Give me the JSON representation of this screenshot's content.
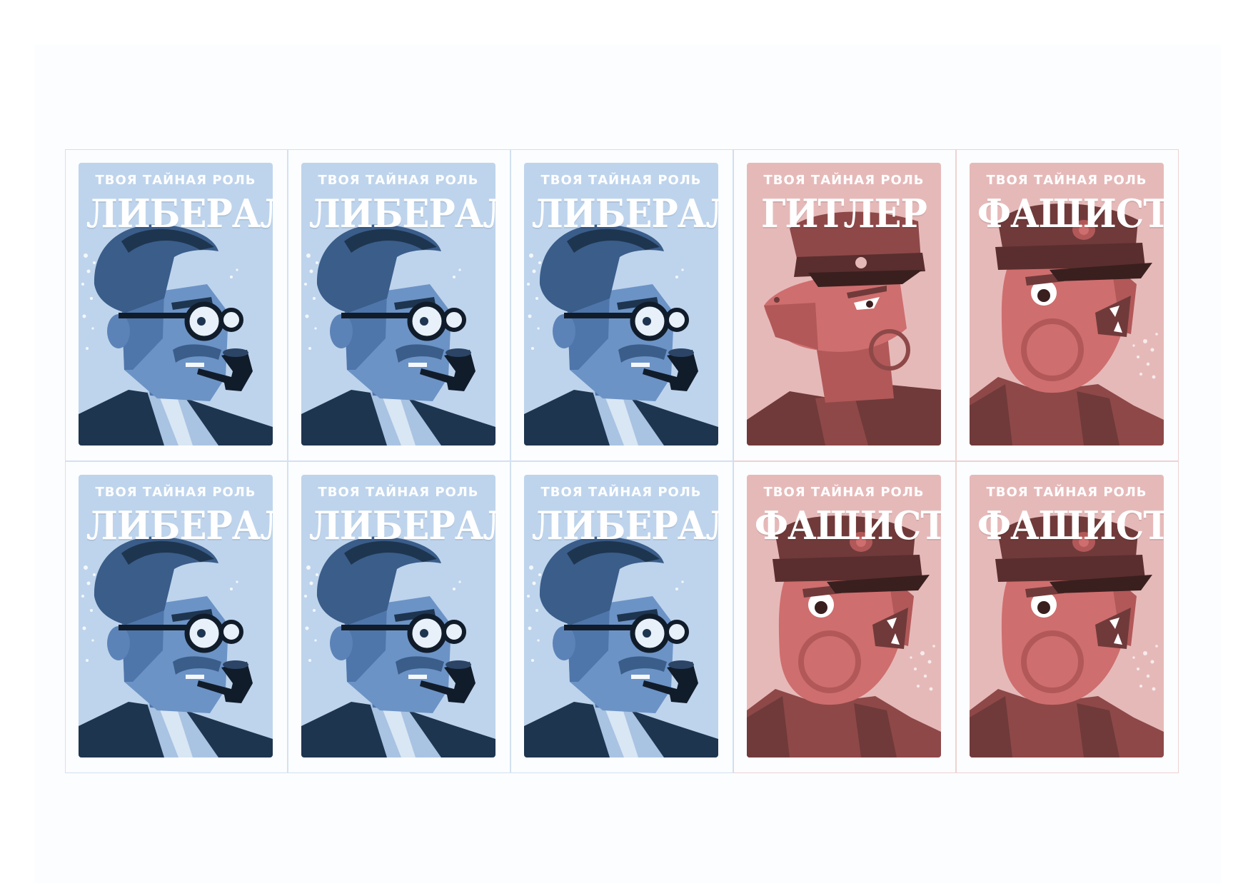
{
  "colors": {
    "liberal_bg": "#bed4ec",
    "liberal_face": "#6c93c6",
    "liberal_shadow": "#4f76aa",
    "liberal_dark": "#1e3550",
    "fascist_bg": "#e6b9b9",
    "fascist_face": "#cf6e6e",
    "fascist_shadow": "#b25858",
    "fascist_dark": "#703a3a"
  },
  "cards": [
    {
      "team": "liberal",
      "subtitle": "ТВОЯ ТАЙНАЯ РОЛЬ",
      "role": "ЛИБЕРАЛ",
      "portrait": "liberal-portrait-icon"
    },
    {
      "team": "liberal",
      "subtitle": "ТВОЯ ТАЙНАЯ РОЛЬ",
      "role": "ЛИБЕРАЛ",
      "portrait": "liberal-portrait-icon"
    },
    {
      "team": "liberal",
      "subtitle": "ТВОЯ ТАЙНАЯ РОЛЬ",
      "role": "ЛИБЕРАЛ",
      "portrait": "liberal-portrait-icon"
    },
    {
      "team": "fascist",
      "subtitle": "ТВОЯ ТАЙНАЯ РОЛЬ",
      "role": "ГИТЛЕР",
      "portrait": "hitler-portrait-icon"
    },
    {
      "team": "fascist",
      "subtitle": "ТВОЯ ТАЙНАЯ РОЛЬ",
      "role": "ФАШИСТ",
      "portrait": "fascist-portrait-icon"
    },
    {
      "team": "liberal",
      "subtitle": "ТВОЯ ТАЙНАЯ РОЛЬ",
      "role": "ЛИБЕРАЛ",
      "portrait": "liberal-portrait-icon"
    },
    {
      "team": "liberal",
      "subtitle": "ТВОЯ ТАЙНАЯ РОЛЬ",
      "role": "ЛИБЕРАЛ",
      "portrait": "liberal-portrait-icon"
    },
    {
      "team": "liberal",
      "subtitle": "ТВОЯ ТАЙНАЯ РОЛЬ",
      "role": "ЛИБЕРАЛ",
      "portrait": "liberal-portrait-icon"
    },
    {
      "team": "fascist",
      "subtitle": "ТВОЯ ТАЙНАЯ РОЛЬ",
      "role": "ФАШИСТ",
      "portrait": "fascist-portrait-icon"
    },
    {
      "team": "fascist",
      "subtitle": "ТВОЯ ТАЙНАЯ РОЛЬ",
      "role": "ФАШИСТ",
      "portrait": "fascist-portrait-icon"
    }
  ]
}
